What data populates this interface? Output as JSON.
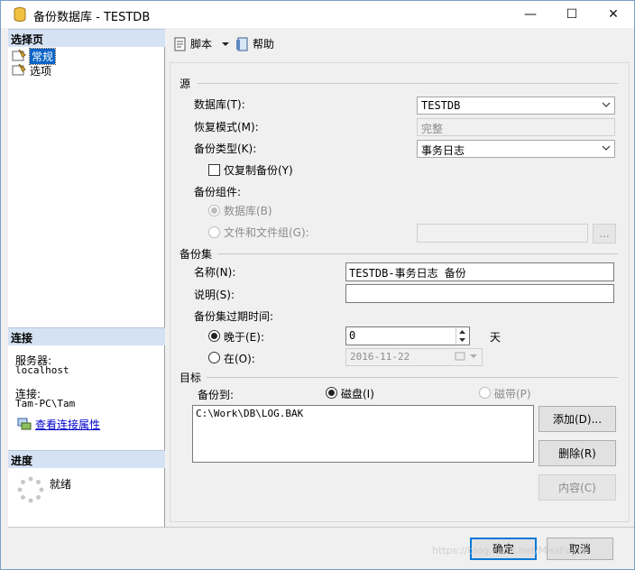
{
  "window": {
    "title": "备份数据库 - TESTDB",
    "minimize": "—",
    "maximize": "☐",
    "close": "✕"
  },
  "sidebar": {
    "select_page": "选择页",
    "pages": [
      {
        "label": "常规",
        "selected": true
      },
      {
        "label": "选项",
        "selected": false
      }
    ],
    "connection": {
      "header": "连接",
      "server_label": "服务器:",
      "server_value": "localhost",
      "conn_label": "连接:",
      "conn_value": "Tam-PC\\Tam",
      "view_props": "查看连接属性"
    },
    "progress": {
      "header": "进度",
      "status": "就绪"
    }
  },
  "toolbar": {
    "script": "脚本",
    "help": "帮助"
  },
  "source": {
    "group": "源",
    "database_label": "数据库(T):",
    "database_value": "TESTDB",
    "recovery_label": "恢复模式(M):",
    "recovery_value": "完整",
    "backup_type_label": "备份类型(K):",
    "backup_type_value": "事务日志",
    "copy_only_label": "仅复制备份(Y)",
    "component_label": "备份组件:",
    "component_db": "数据库(B)",
    "component_files": "文件和文件组(G):",
    "browse": "..."
  },
  "backup_set": {
    "group": "备份集",
    "name_label": "名称(N):",
    "name_value": "TESTDB-事务日志  备份",
    "desc_label": "说明(S):",
    "desc_value": "",
    "expire_label": "备份集过期时间:",
    "after_label": "晚于(E):",
    "after_value": "0",
    "days": "天",
    "on_label": "在(O):",
    "on_value": "2016-11-22"
  },
  "destination": {
    "group": "目标",
    "backup_to_label": "备份到:",
    "disk": "磁盘(I)",
    "tape": "磁带(P)",
    "paths": [
      "C:\\Work\\DB\\LOG.BAK"
    ],
    "add": "添加(D)...",
    "remove": "删除(R)",
    "contents": "内容(C)"
  },
  "footer": {
    "ok": "确定",
    "cancel": "取消",
    "watermark": "https://blog.csdn.net/MissFoyer"
  }
}
